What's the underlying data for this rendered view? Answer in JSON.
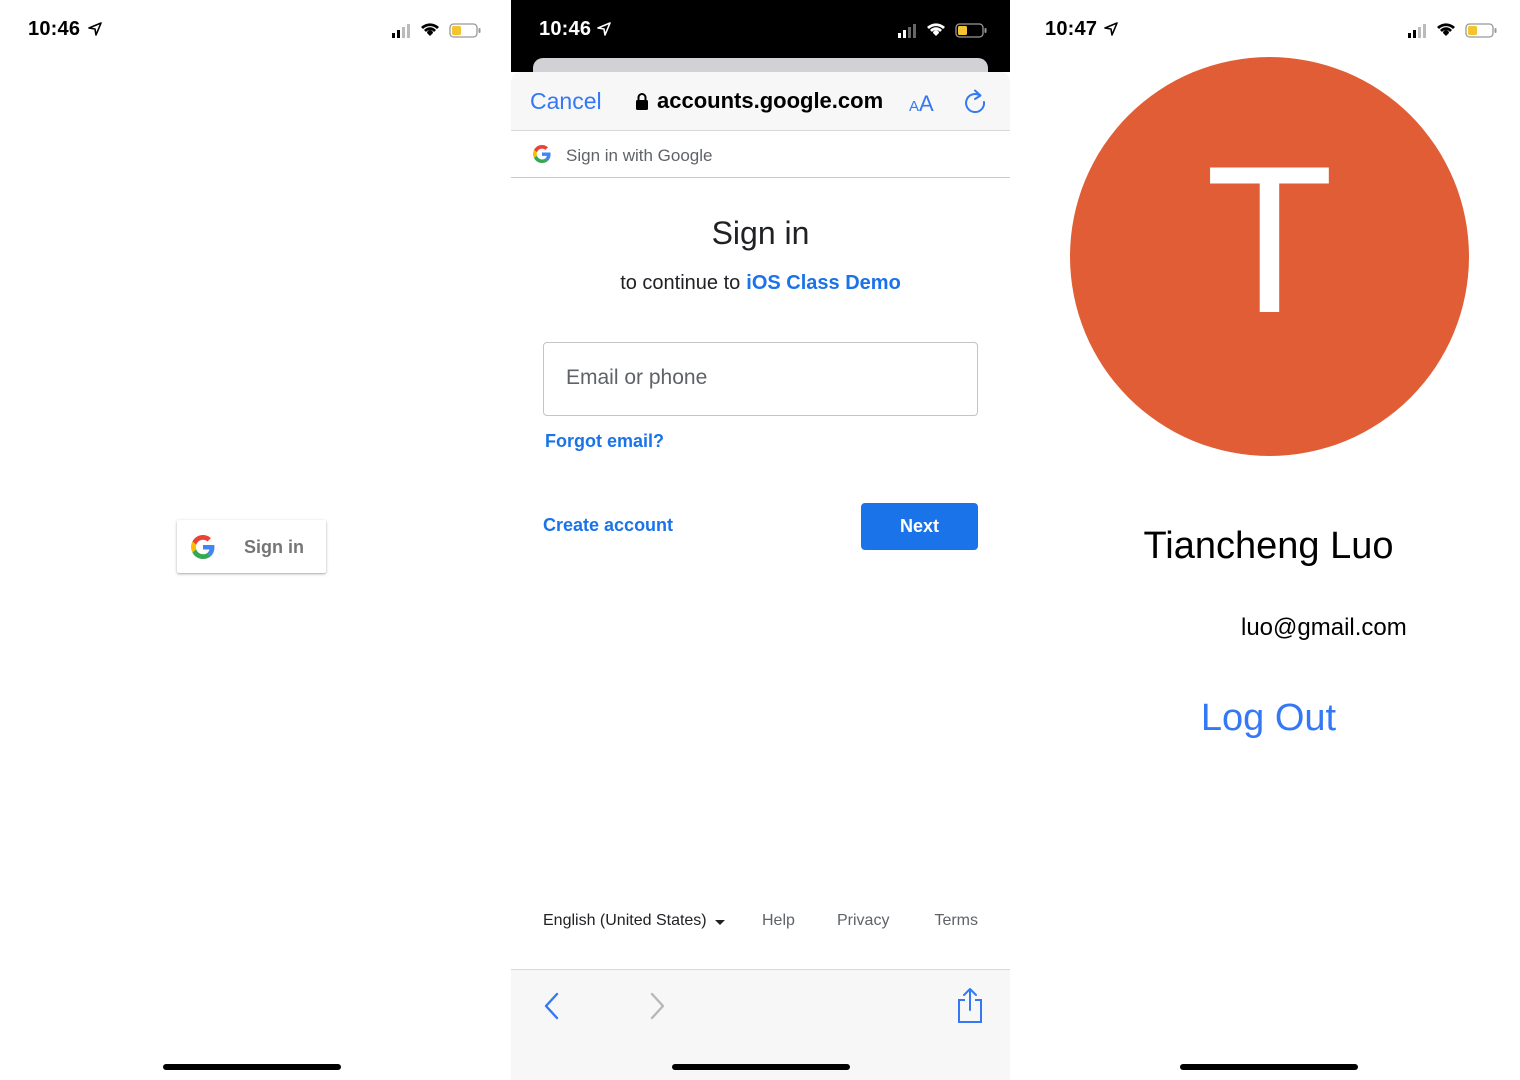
{
  "screens": {
    "signin_button": {
      "status": {
        "time": "10:46"
      },
      "google_button": {
        "label": "Sign in"
      }
    },
    "google_auth": {
      "status": {
        "time": "10:46"
      },
      "browser": {
        "cancel_label": "Cancel",
        "url": "accounts.google.com",
        "text_size_small": "A",
        "text_size_large": "A"
      },
      "header": {
        "label": "Sign in with Google"
      },
      "title": "Sign in",
      "continue_prefix": "to continue to",
      "app_name": "iOS Class Demo",
      "email_field": {
        "placeholder": "Email or phone"
      },
      "forgot_email": "Forgot email?",
      "create_account": "Create account",
      "next_button": "Next",
      "footer": {
        "language": "English (United States)",
        "help": "Help",
        "privacy": "Privacy",
        "terms": "Terms"
      }
    },
    "profile": {
      "status": {
        "time": "10:47"
      },
      "avatar_initial": "T",
      "avatar_color": "#e05d35",
      "name": "Tiancheng Luo",
      "email": "luo@gmail.com",
      "logout_label": "Log Out"
    }
  },
  "colors": {
    "ios_blue": "#3478f6",
    "google_blue": "#1a73e8"
  },
  "icons": [
    "location-arrow-icon",
    "signal-icon",
    "wifi-icon",
    "battery-icon",
    "google-g-icon",
    "lock-icon",
    "reload-icon",
    "back-chevron-icon",
    "forward-chevron-icon",
    "share-icon",
    "dropdown-caret-icon"
  ]
}
